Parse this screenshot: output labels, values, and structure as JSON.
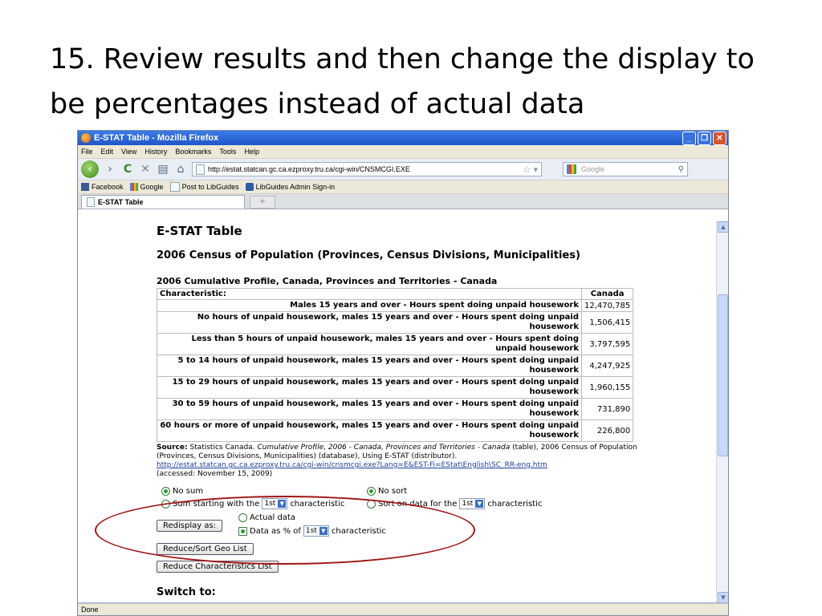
{
  "slide": {
    "title": "15. Review results and then change the display to be percentages instead of actual data"
  },
  "browser": {
    "window_title": "E-STAT Table - Mozilla Firefox",
    "menu": [
      "File",
      "Edit",
      "View",
      "History",
      "Bookmarks",
      "Tools",
      "Help"
    ],
    "url": "http://estat.statcan.gc.ca.ezproxy.tru.ca/cgi-win/CNSMCGI.EXE",
    "search_placeholder": "Google",
    "bookmarks": [
      "Facebook",
      "Google",
      "Post to LibGuides",
      "LibGuides Admin Sign-in"
    ],
    "tab_label": "E-STAT Table",
    "new_tab": "+",
    "status": "Done"
  },
  "page": {
    "heading": "E-STAT Table",
    "subheading": "2006 Census of Population (Provinces, Census Divisions, Municipalities)",
    "table_title": "2006 Cumulative Profile, Canada, Provinces and Territories - Canada",
    "table": {
      "header_characteristic": "Characteristic:",
      "header_column": "Canada",
      "rows": [
        {
          "label": "Males 15 years and over - Hours spent doing unpaid housework",
          "value": "12,470,785"
        },
        {
          "label": "No hours of unpaid housework, males 15 years and over - Hours spent doing unpaid housework",
          "value": "1,506,415"
        },
        {
          "label": "Less than 5 hours of unpaid housework, males 15 years and over - Hours spent doing unpaid housework",
          "value": "3,797,595"
        },
        {
          "label": "5 to 14 hours of unpaid housework, males 15 years and over - Hours spent doing unpaid housework",
          "value": "4,247,925"
        },
        {
          "label": "15 to 29 hours of unpaid housework, males 15 years and over - Hours spent doing unpaid housework",
          "value": "1,960,155"
        },
        {
          "label": "30 to 59 hours of unpaid housework, males 15 years and over - Hours spent doing unpaid housework",
          "value": "731,890"
        },
        {
          "label": "60 hours or more of unpaid housework, males 15 years and over - Hours spent doing unpaid housework",
          "value": "226,800"
        }
      ]
    },
    "source": {
      "label": "Source:",
      "text_1": "Statistics Canada.",
      "title_italic": "Cumulative Profile, 2006 - Canada, Provinces and Territories - Canada",
      "text_2": "(table), 2006 Census of Population (Provinces, Census Divisions, Municipalities) (database), Using E-STAT (distributor).",
      "link": "http://estat.statcan.gc.ca.ezproxy.tru.ca/cgi-win/cnsmcgi.exe?Lang=E&EST-Fi=EStat\\English\\SC_RR-eng.htm",
      "accessed": "(accessed: November 15, 2009)"
    },
    "form": {
      "no_sum": "No sum",
      "sum_starting": "Sum starting with the",
      "sum_select": "1st",
      "sum_suffix": "characteristic",
      "no_sort": "No sort",
      "sort_on": "Sort on data for the",
      "sort_select": "1st",
      "sort_suffix": "characteristic",
      "redisplay_button": "Redisplay as:",
      "actual_data": "Actual data",
      "data_as_pct": "Data as % of",
      "pct_select": "1st",
      "pct_suffix": "characteristic",
      "reduce_sort_geo": "Reduce/Sort Geo List",
      "reduce_characteristics": "Reduce Characteristics List",
      "switch_to": "Switch to:"
    }
  },
  "colors": {
    "annotation_oval": "#a01515",
    "titlebar": "#1f56c9",
    "link": "#1a3f9a"
  }
}
